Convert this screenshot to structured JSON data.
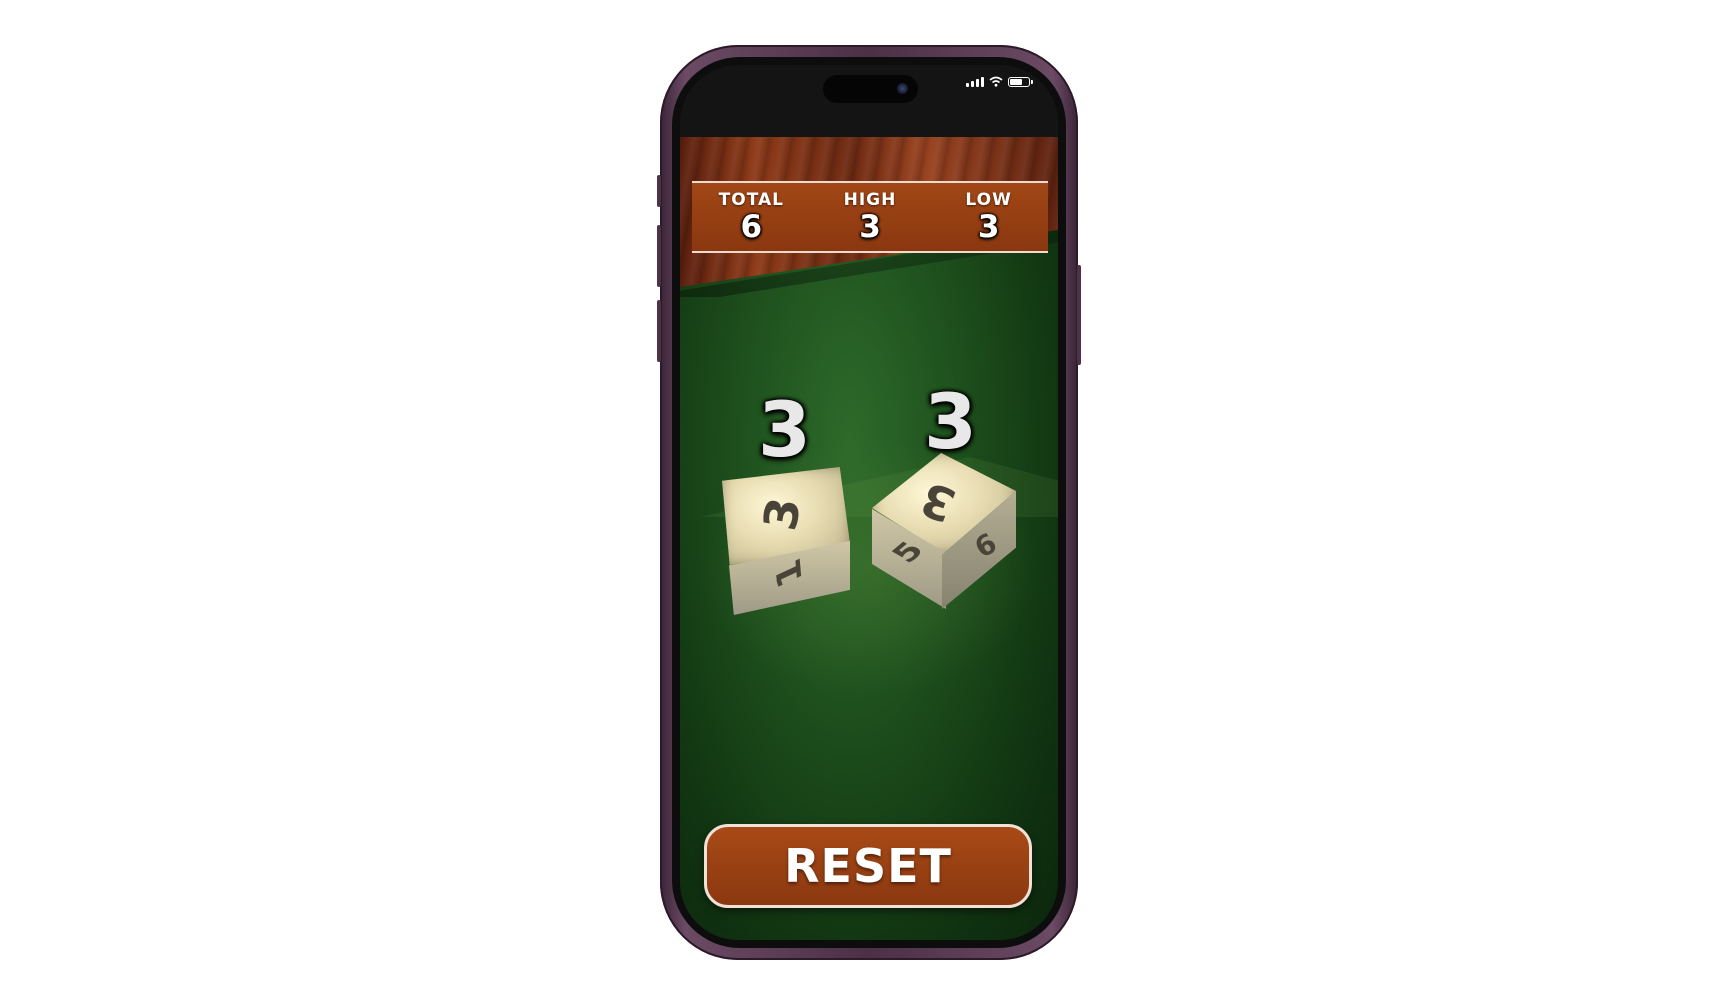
{
  "status_bar": {
    "icons": [
      "signal-icon",
      "wifi-icon",
      "battery-icon"
    ],
    "signal_bars": 4,
    "battery_level": 0.7
  },
  "scoreboard": {
    "items": [
      {
        "label": "TOTAL",
        "value": "6"
      },
      {
        "label": "HIGH",
        "value": "3"
      },
      {
        "label": "LOW",
        "value": "3"
      }
    ]
  },
  "dice": [
    {
      "result": "3",
      "top_face": "3",
      "side_face": "1"
    },
    {
      "result": "3",
      "top_face": "3",
      "side_face_left": "5",
      "side_face_right": "6"
    }
  ],
  "controls": {
    "reset_label": "RESET"
  },
  "colors": {
    "felt": "#1f521e",
    "wood": "#8e3a18",
    "button": "#a84a16",
    "phone_frame": "#4b3046"
  }
}
